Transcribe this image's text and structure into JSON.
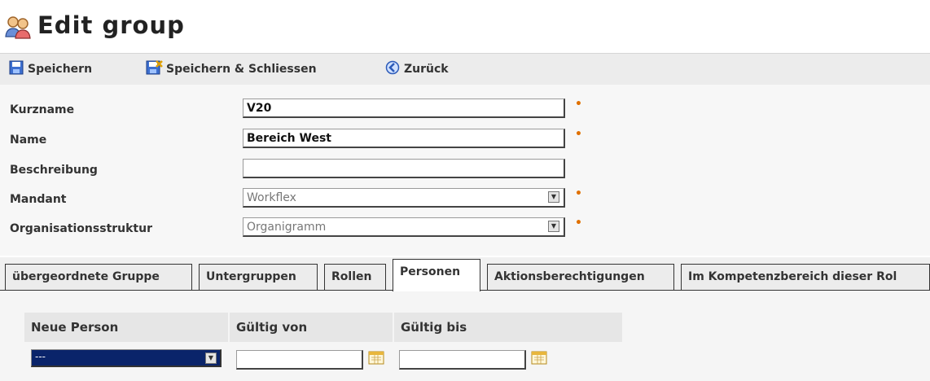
{
  "window": {
    "title": "Edit group"
  },
  "toolbar": {
    "save_label": "Speichern",
    "save_close_label": "Speichern & Schliessen",
    "back_label": "Zurück"
  },
  "form": {
    "kurzname": {
      "label": "Kurzname",
      "value": "V20",
      "required": true
    },
    "name": {
      "label": "Name",
      "value": "Bereich West",
      "required": true
    },
    "beschreibung": {
      "label": "Beschreibung",
      "value": ""
    },
    "mandant": {
      "label": "Mandant",
      "value": "Workflex",
      "required": true
    },
    "organisation": {
      "label": "Organisationsstruktur",
      "value": "Organigramm",
      "required": true
    },
    "required_marker": "•"
  },
  "tabs": [
    {
      "label": "übergeordnete Gruppe",
      "active": false
    },
    {
      "label": "Untergruppen",
      "active": false
    },
    {
      "label": "Rollen",
      "active": false
    },
    {
      "label": "Personen",
      "active": true
    },
    {
      "label": "Aktionsberechtigungen",
      "active": false
    },
    {
      "label": "Im Kompetenzbereich dieser Rol",
      "active": false
    }
  ],
  "personen": {
    "columns": [
      "Neue Person",
      "Gültig von",
      "Gültig bis"
    ],
    "selected_person": "---",
    "valid_from": "",
    "valid_to": ""
  },
  "colors": {
    "accent_blue": "#0a246a",
    "required": "#e07000",
    "toolbar_bg": "#ececec"
  },
  "icons": {
    "title": "group-users-icon",
    "save": "save-icon",
    "save_close": "save-close-icon",
    "back": "back-icon",
    "calendar": "calendar-icon"
  }
}
